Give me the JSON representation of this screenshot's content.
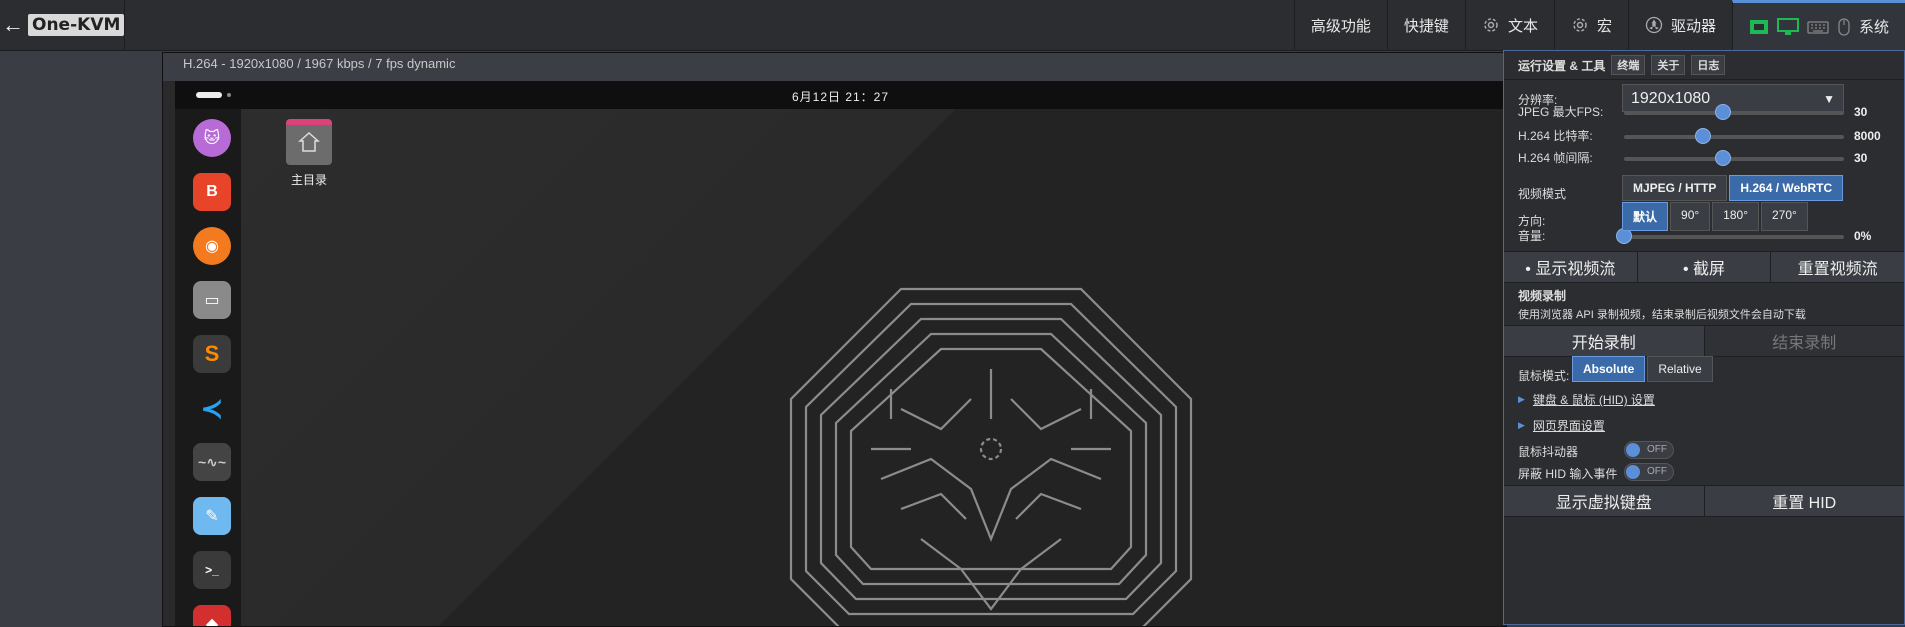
{
  "topbar": {
    "back_icon": "←",
    "logo": "One-KVM",
    "nav": [
      "高级功能",
      "快捷键",
      "文本",
      "宏",
      "驱动器",
      "系统"
    ]
  },
  "stream": {
    "header": "H.264 - 1920x1080 / 1967 kbps / 7 fps dynamic",
    "clock": "6月12日 21：27",
    "home_label": "主目录"
  },
  "panel": {
    "title": "运行设置 & 工具",
    "tabs": [
      "终端",
      "关于",
      "日志"
    ],
    "resolution_label": "分辨率:",
    "resolution_value": "1920x1080",
    "resolution_arrow": "▼",
    "sliders": [
      {
        "label": "JPEG 最大FPS:",
        "value": "30",
        "level": 0.45
      },
      {
        "label": "H.264 比特率:",
        "value": "8000",
        "level": 0.36
      },
      {
        "label": "H.264 帧间隔:",
        "value": "30",
        "level": 0.45
      },
      {
        "label": "音量:",
        "value": "0%",
        "level": 0
      }
    ],
    "video_mode_label": "视频模式",
    "video_modes": [
      "MJPEG / HTTP",
      "H.264 / WebRTC"
    ],
    "orientation_label": "方向:",
    "orientations": [
      "默认",
      "90°",
      "180°",
      "270°"
    ],
    "stream_buttons": [
      "• 显示视频流",
      "• 截屏",
      "重置视频流"
    ],
    "record_title": "视频录制",
    "record_desc": "使用浏览器 API 录制视频，结束录制后视频文件会自动下载",
    "record_buttons": [
      "开始录制",
      "结束录制"
    ],
    "mouse_mode_label": "鼠标模式:",
    "mouse_modes": [
      "Absolute",
      "Relative"
    ],
    "hid_settings": "键盘 & 鼠标 (HID) 设置",
    "web_settings": "网页界面设置",
    "jiggler_label": "鼠标抖动器",
    "block_hid_label": "屏蔽 HID 输入事件",
    "toggle_off": "OFF",
    "bottom_buttons": [
      "显示虚拟键盘",
      "重置 HID"
    ]
  },
  "colors": {
    "accent": "#5b8fd8",
    "active_tab_border": "#4b6a9b"
  }
}
